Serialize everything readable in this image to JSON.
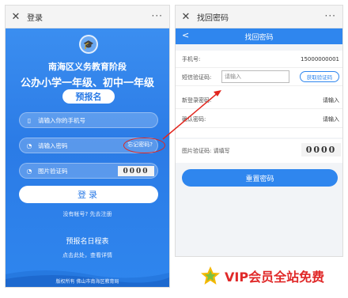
{
  "left_screen": {
    "window_title": "登录",
    "more_label": "···",
    "close_label": "✕",
    "title_line1": "南海区义务教育阶段",
    "title_line2": "公办小学一年级、初中一年级",
    "badge": "预报名",
    "phone_placeholder": "请输入你的手机号",
    "password_placeholder": "请输入密码",
    "forgot_link": "忘记密码?",
    "captcha_placeholder": "图片验证码",
    "captcha_text": "0000",
    "login_button": "登录",
    "register_text": "没有帐号? 先去注册",
    "flow_title": "预报名日程表",
    "flow_subtitle": "点击此处，查看详情",
    "footer": "版权所有 佛山市南海区教育局"
  },
  "right_screen": {
    "window_title": "找回密码",
    "more_label": "···",
    "close_label": "✕",
    "nav_title": "找回密码",
    "nav_back": "<",
    "phone_label": "手机号:",
    "phone_value": "15000000001",
    "sms_label": "短信验证码:",
    "sms_placeholder": "请输入",
    "sms_button": "获取验证码",
    "new_password_label": "新登录密码:",
    "new_password_placeholder": "请输入",
    "confirm_password_label": "确认密码:",
    "confirm_password_placeholder": "请输入",
    "captcha_label": "图片验证码: 请填写",
    "captcha_text": "0000",
    "reset_button": "重置密码"
  },
  "watermark": {
    "text": "VIP会员全站免费"
  },
  "colors": {
    "primary_blue": "#2f86ee",
    "highlight_red": "#e2261e",
    "watermark_red": "#e02828",
    "watermark_gold": "#f5b800"
  }
}
